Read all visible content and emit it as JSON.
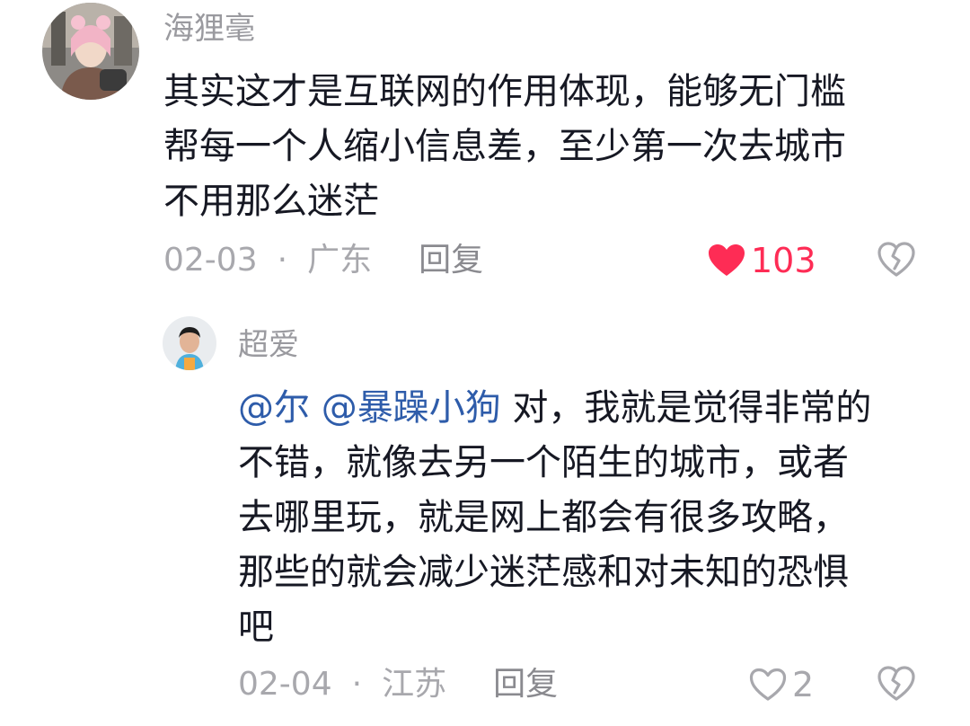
{
  "comments": [
    {
      "username": "海狸毫",
      "lines": [
        "其实这才是互联网的作用体现，能够无门槛",
        "帮每一个人缩小信息差，至少第一次去城市",
        "不用那么迷茫"
      ],
      "date": "02-03",
      "separator": "·",
      "location": "广东",
      "reply_label": "回复",
      "likes": "103",
      "liked": true,
      "like_color": "#fe2c55",
      "avatar_icon": "user-avatar-photo"
    },
    {
      "username": "超爱",
      "mentions": [
        "@尔",
        "@暴躁小狗"
      ],
      "first_line_rest": " 对，我就是觉得非常的",
      "lines": [
        "不错，就像去另一个陌生的城市，或者",
        "去哪里玩，就是网上都会有很多攻略，",
        "那些的就会减少迷茫感和对未知的恐惧",
        "吧"
      ],
      "date": "02-04",
      "separator": "·",
      "location": "江苏",
      "reply_label": "回复",
      "likes": "2",
      "liked": false,
      "mention_color": "#2e5caa",
      "avatar_icon": "user-avatar-photo"
    }
  ]
}
